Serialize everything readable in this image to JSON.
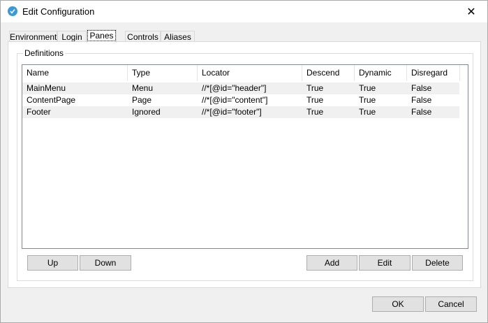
{
  "window": {
    "title": "Edit Configuration"
  },
  "tabs": [
    {
      "label": "Environment",
      "active": false
    },
    {
      "label": "Login",
      "active": false
    },
    {
      "label": "Panes",
      "active": true
    },
    {
      "label": "Controls",
      "active": false
    },
    {
      "label": "Aliases",
      "active": false
    }
  ],
  "definitions": {
    "group_label": "Definitions",
    "columns": [
      "Name",
      "Type",
      "Locator",
      "Descend",
      "Dynamic",
      "Disregard"
    ],
    "rows": [
      [
        "MainMenu",
        "Menu",
        "//*[@id=\"header\"]",
        "True",
        "True",
        "False"
      ],
      [
        "ContentPage",
        "Page",
        "//*[@id=\"content\"]",
        "True",
        "True",
        "False"
      ],
      [
        "Footer",
        "Ignored",
        "//*[@id=\"footer\"]",
        "True",
        "True",
        "False"
      ]
    ]
  },
  "buttons": {
    "up": "Up",
    "down": "Down",
    "add": "Add",
    "edit": "Edit",
    "delete": "Delete",
    "ok": "OK",
    "cancel": "Cancel"
  },
  "colors": {
    "icon_accent": "#3a9ad9",
    "row_alt": "#f0f0f0"
  }
}
